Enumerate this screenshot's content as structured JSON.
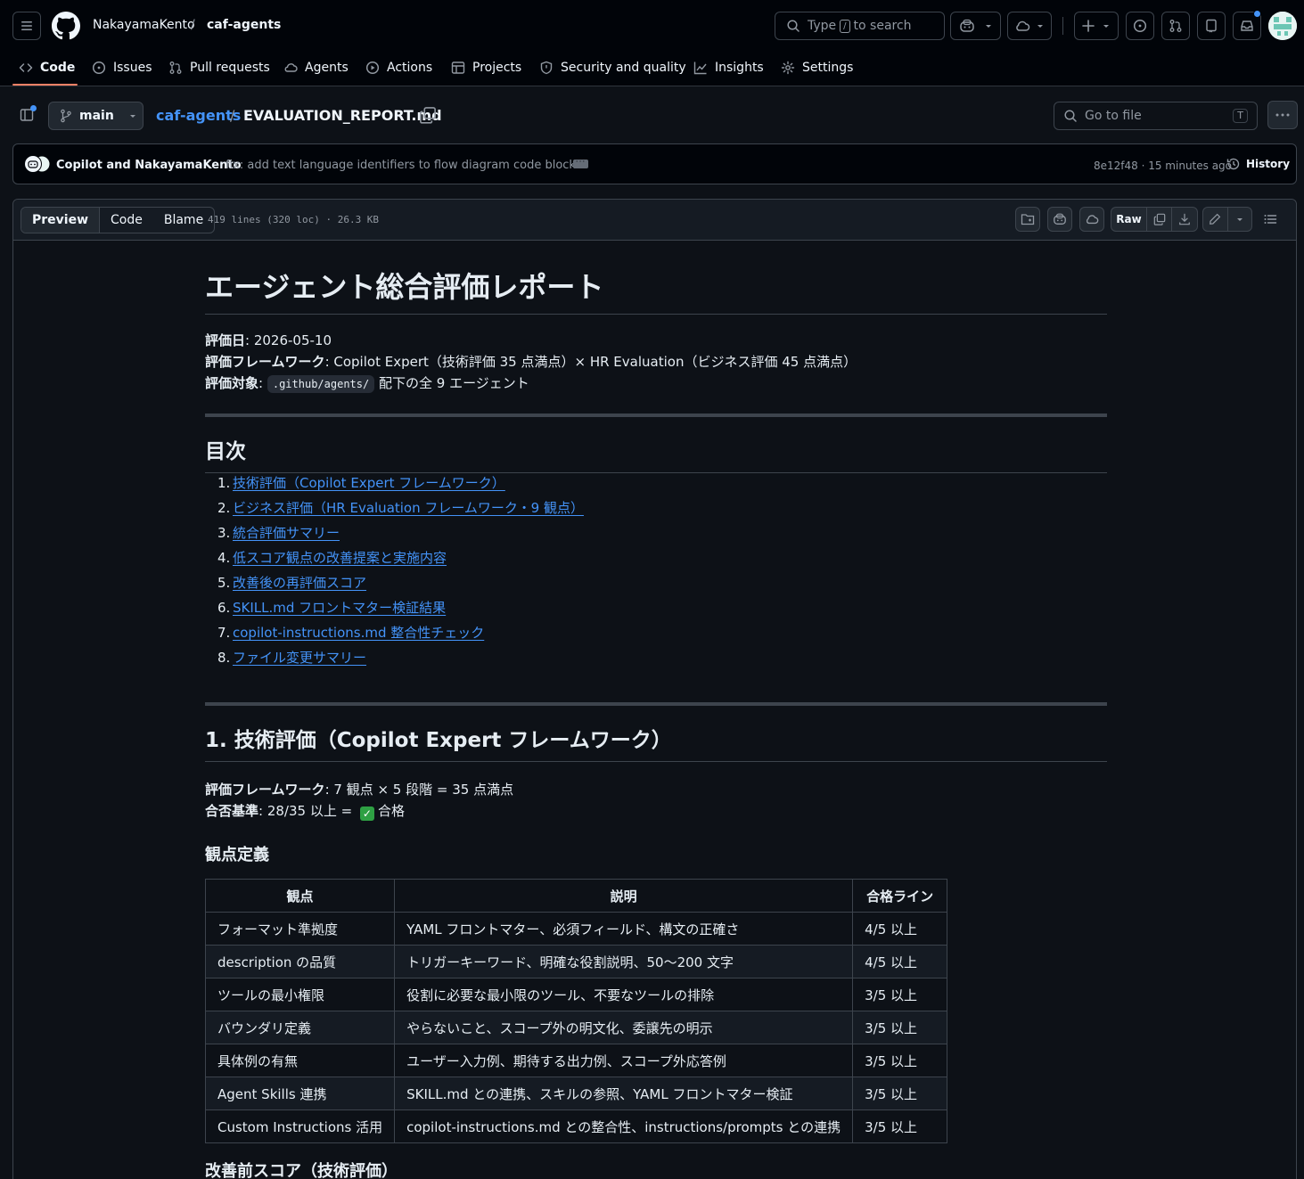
{
  "header": {
    "owner": "NakayamaKento",
    "separator": "/",
    "repo": "caf-agents",
    "search": {
      "prefix": "Type",
      "key": "/",
      "suffix": "to search"
    }
  },
  "repo_nav": [
    {
      "label": "Code",
      "icon": "code-icon",
      "active": true
    },
    {
      "label": "Issues",
      "icon": "issue-icon"
    },
    {
      "label": "Pull requests",
      "icon": "pull-request-icon"
    },
    {
      "label": "Agents",
      "icon": "agents-icon"
    },
    {
      "label": "Actions",
      "icon": "play-icon"
    },
    {
      "label": "Projects",
      "icon": "table-icon"
    },
    {
      "label": "Security and quality",
      "icon": "shield-icon"
    },
    {
      "label": "Insights",
      "icon": "graph-icon"
    },
    {
      "label": "Settings",
      "icon": "gear-icon"
    }
  ],
  "file_header": {
    "branch": "main",
    "breadcrumb_repo": "caf-agents",
    "breadcrumb_sep": "/",
    "file_name": "EVALUATION_REPORT.md",
    "goto_placeholder": "Go to file",
    "goto_key": "T"
  },
  "commit": {
    "authors": "Copilot and NakayamaKento",
    "message": "fix: add text language identifiers to flow diagram code blocks",
    "meta": "8e12f48 · 15 minutes ago",
    "history_label": "History"
  },
  "file_toolbar": {
    "tabs": [
      "Preview",
      "Code",
      "Blame"
    ],
    "info": "419 lines (320 loc) · 26.3 KB",
    "raw_label": "Raw"
  },
  "doc": {
    "title": "エージェント総合評価レポート",
    "meta": [
      {
        "label": "評価日",
        "text": ": 2026-05-10"
      },
      {
        "label": "評価フレームワーク",
        "text": ": Copilot Expert（技術評価 35 点満点）× HR Evaluation（ビジネス評価 45 点満点）"
      },
      {
        "label": "評価対象",
        "text_before": ": ",
        "code": ".github/agents/",
        "text_after": " 配下の全 9 エージェント"
      }
    ],
    "toc_heading": "目次",
    "toc": [
      "技術評価（Copilot Expert フレームワーク）",
      "ビジネス評価（HR Evaluation フレームワーク・9 観点）",
      "統合評価サマリー",
      "低スコア観点の改善提案と実施内容",
      "改善後の再評価スコア",
      "SKILL.md フロントマター検証結果",
      "copilot-instructions.md 整合性チェック",
      "ファイル変更サマリー"
    ],
    "section1_heading": "1. 技術評価（Copilot Expert フレームワーク）",
    "section1_framework": {
      "label": "評価フレームワーク",
      "text": ": 7 観点 × 5 段階 = 35 点満点"
    },
    "section1_pass": {
      "label": "合否基準",
      "text": ": 28/35 以上 = ",
      "check": "✓",
      "result": "合格"
    },
    "criteria_heading": "観点定義",
    "criteria_table": {
      "headers": [
        "観点",
        "説明",
        "合格ライン"
      ],
      "rows": [
        [
          "フォーマット準拠度",
          "YAML フロントマター、必須フィールド、構文の正確さ",
          "4/5 以上"
        ],
        [
          "description の品質",
          "トリガーキーワード、明確な役割説明、50〜200 文字",
          "4/5 以上"
        ],
        [
          "ツールの最小権限",
          "役割に必要な最小限のツール、不要なツールの排除",
          "3/5 以上"
        ],
        [
          "バウンダリ定義",
          "やらないこと、スコープ外の明文化、委譲先の明示",
          "3/5 以上"
        ],
        [
          "具体例の有無",
          "ユーザー入力例、期待する出力例、スコープ外応答例",
          "3/5 以上"
        ],
        [
          "Agent Skills 連携",
          "SKILL.md との連携、スキルの参照、YAML フロントマター検証",
          "3/5 以上"
        ],
        [
          "Custom Instructions 活用",
          "copilot-instructions.md との整合性、instructions/prompts との連携",
          "3/5 以上"
        ]
      ]
    },
    "next_heading": "改善前スコア（技術評価）"
  },
  "colors": {
    "accent": "#4493f8",
    "nav_underline": "#f78166",
    "bg": "#0d1117",
    "header_bg": "#010409",
    "border": "#3d444d"
  }
}
